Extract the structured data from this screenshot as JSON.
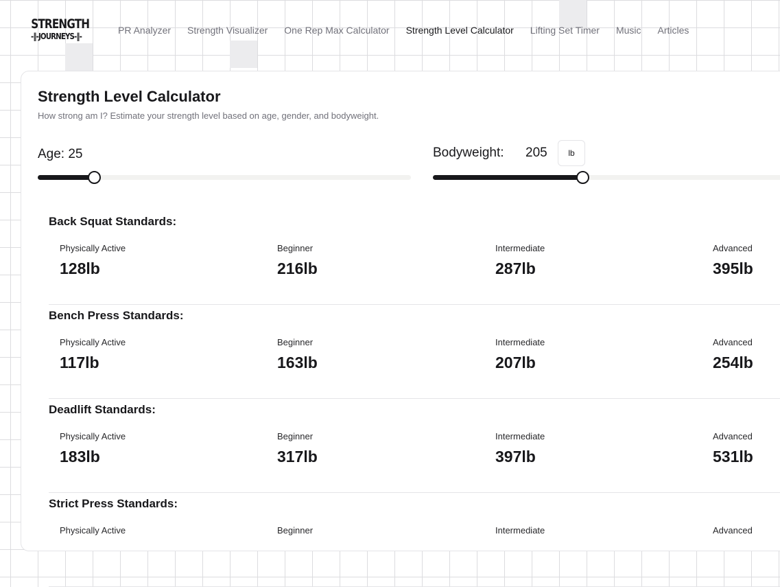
{
  "logo": {
    "line1": "STRENGTH",
    "line2": "-‖-JOURNEYS-‖-"
  },
  "nav": [
    "PR Analyzer",
    "Strength Visualizer",
    "One Rep Max Calculator",
    "Strength Level Calculator",
    "Lifting Set Timer",
    "Music",
    "Articles"
  ],
  "title": "Strength Level Calculator",
  "subtitle": "How strong am I? Estimate your strength level based on age, gender, and bodyweight.",
  "age": {
    "label": "Age: 25",
    "value": 25,
    "fraction": 0.15
  },
  "bodyweight": {
    "label": "Bodyweight:",
    "value": "205",
    "unit": "lb",
    "fraction": 0.4
  },
  "levels": [
    "Physically Active",
    "Beginner",
    "Intermediate",
    "Advanced"
  ],
  "sections": [
    {
      "title": "Back Squat Standards:",
      "values": [
        "128lb",
        "216lb",
        "287lb",
        "395lb"
      ]
    },
    {
      "title": "Bench Press Standards:",
      "values": [
        "117lb",
        "163lb",
        "207lb",
        "254lb"
      ]
    },
    {
      "title": "Deadlift Standards:",
      "values": [
        "183lb",
        "317lb",
        "397lb",
        "531lb"
      ]
    },
    {
      "title": "Strict Press Standards:",
      "values": [
        "",
        "",
        "",
        ""
      ]
    }
  ]
}
